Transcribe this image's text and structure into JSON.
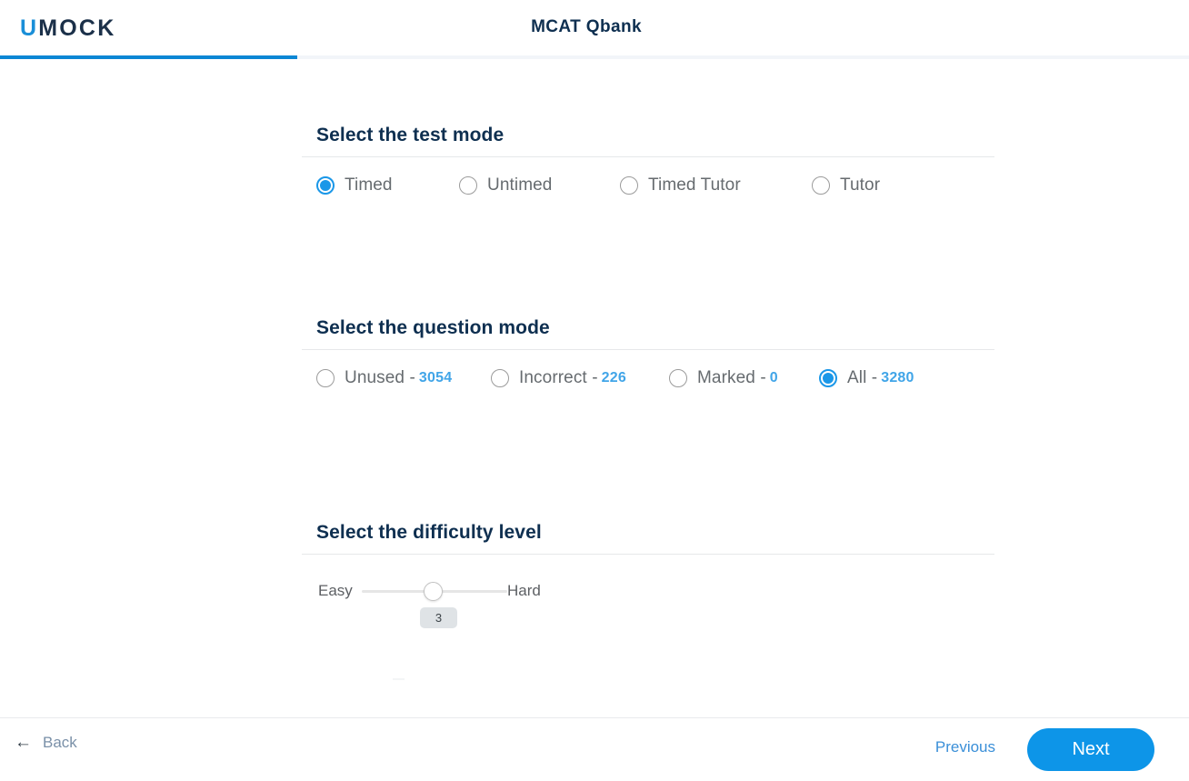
{
  "header": {
    "logo_u": "U",
    "logo_rest": "MOCK",
    "title": "MCAT Qbank",
    "progress_percent": 25,
    "accent_color": "#0b87d4",
    "logo_accent_color": "#1a8fd8",
    "title_color": "#0e2f50"
  },
  "sections": {
    "test_mode": {
      "title": "Select the test mode",
      "options": [
        {
          "label": "Timed",
          "selected": true
        },
        {
          "label": "Untimed",
          "selected": false
        },
        {
          "label": "Timed Tutor",
          "selected": false
        },
        {
          "label": "Tutor",
          "selected": false
        }
      ]
    },
    "question_mode": {
      "title": "Select the question mode",
      "options": [
        {
          "label": "Unused -",
          "count": "3054",
          "selected": false
        },
        {
          "label": "Incorrect -",
          "count": "226",
          "selected": false
        },
        {
          "label": "Marked -",
          "count": "0",
          "selected": false
        },
        {
          "label": "All -",
          "count": "3280",
          "selected": true
        }
      ]
    },
    "difficulty": {
      "title": "Select the difficulty level",
      "easy_label": "Easy",
      "hard_label": "Hard",
      "value": "3",
      "min": 1,
      "max": 5
    }
  },
  "footer": {
    "back_arrow": "←",
    "back_label": "Back",
    "previous_label": "Previous",
    "next_label": "Next",
    "next_color": "#0d95e8"
  }
}
